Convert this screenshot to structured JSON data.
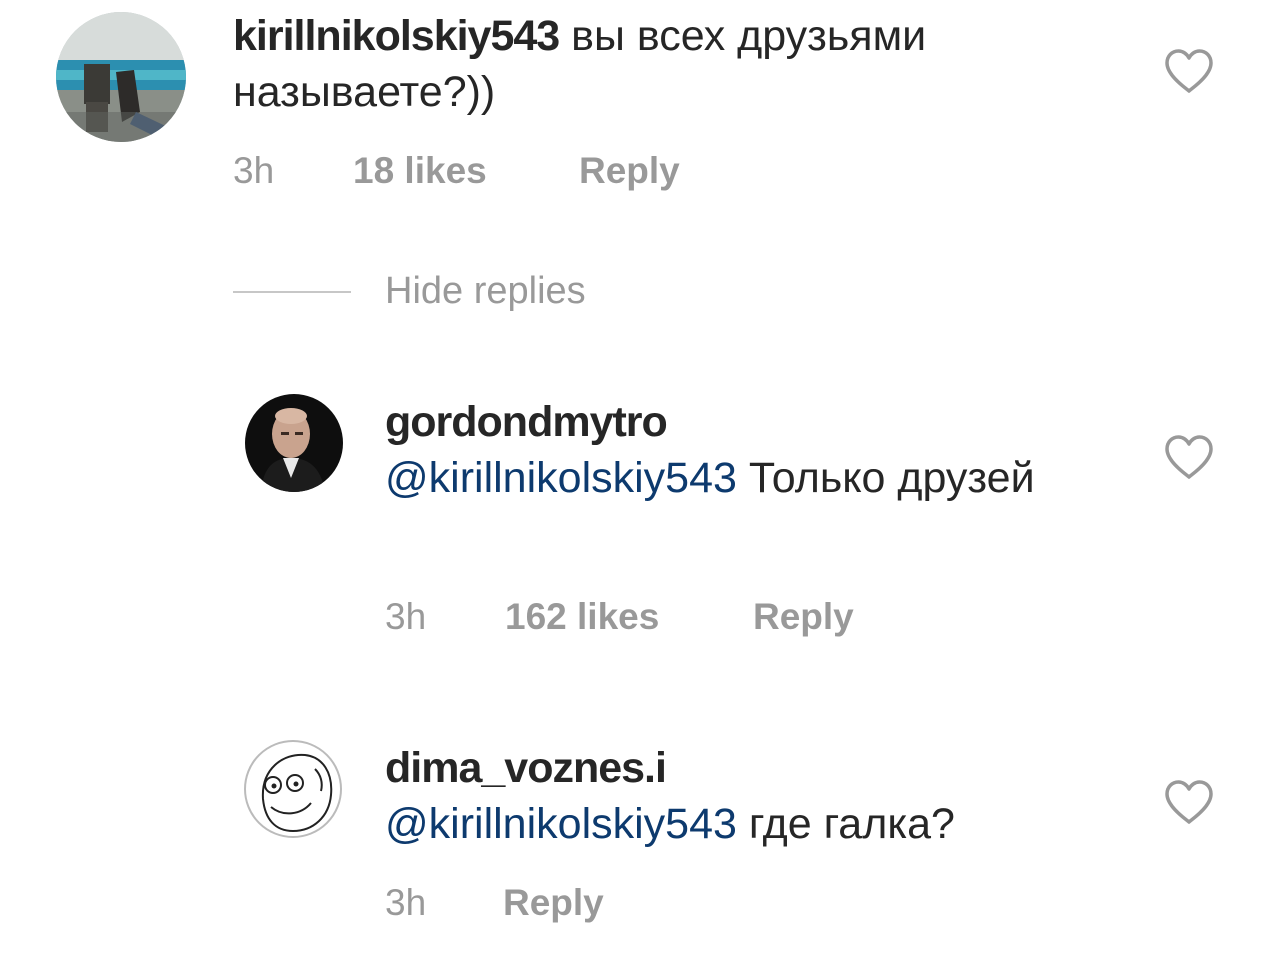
{
  "comments": [
    {
      "username": "kirillnikolskiy543",
      "text": " вы всех друзьями называете?))",
      "time": "3h",
      "likes": "18 likes",
      "reply": "Reply"
    },
    {
      "username": "gordondmytro",
      "mention": "@kirillnikolskiy543",
      "text": " Только друзей",
      "time": "3h",
      "likes": "162 likes",
      "reply": "Reply"
    },
    {
      "username": "dima_voznes.i",
      "mention": "@kirillnikolskiy543",
      "text": " где галка?",
      "time": "3h",
      "reply": "Reply"
    }
  ],
  "hide_replies": "Hide replies",
  "icons": {
    "like": "heart-outline-icon"
  },
  "colors": {
    "mention": "#0d3a6e",
    "meta": "#999999",
    "text": "#262626"
  }
}
